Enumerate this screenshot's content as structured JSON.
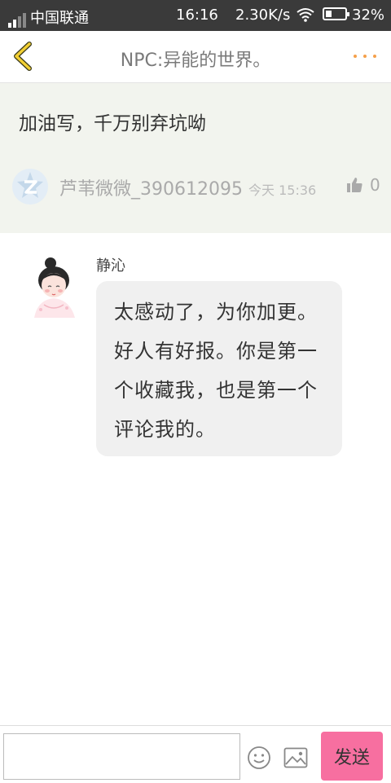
{
  "status_bar": {
    "carrier": "中国联通",
    "time": "16:16",
    "speed": "2.30K/s",
    "battery": "32%",
    "battery_level": 0.32
  },
  "header": {
    "title": "NPC:异能的世界。"
  },
  "comment": {
    "text": "加油写，千万别弃坑呦",
    "username": "芦苇微微_390612095",
    "time": "今天 15:36",
    "likes": "0"
  },
  "reply": {
    "author": "静沁",
    "text": "太感动了，为你加更。好人有好报。你是第一个收藏我，也是第一个评论我的。"
  },
  "input_bar": {
    "value": "",
    "placeholder": "",
    "send_label": "发送"
  },
  "colors": {
    "accent": "#f76fa0",
    "back_arrow": "#f2cf34",
    "more_dots": "#f5a04a",
    "comment_bg": "#f2f4ee"
  },
  "icons": [
    "back-arrow-icon",
    "more-icon",
    "signal-icon",
    "wifi-icon",
    "battery-icon",
    "thumbs-up-icon",
    "emoji-icon",
    "image-icon"
  ]
}
